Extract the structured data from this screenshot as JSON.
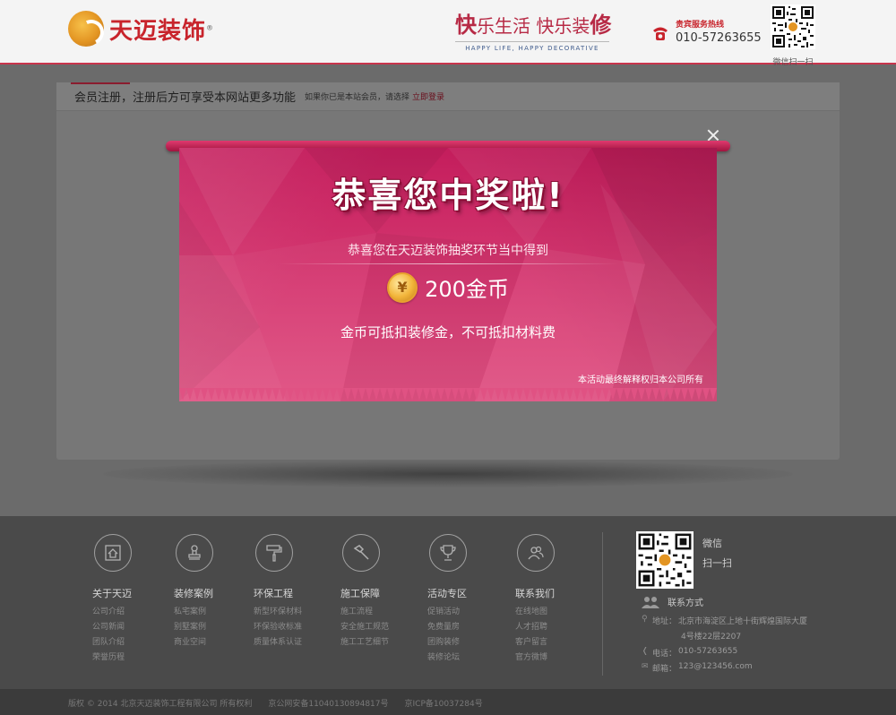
{
  "header": {
    "brand": "天迈装饰",
    "brand_mark": "®",
    "slogan_k1": "快",
    "slogan_rest": "乐生活",
    "slogan_second": "快乐装",
    "slogan_k2": "修",
    "slogan_en": "HAPPY LIFE, HAPPY DECORATIVE",
    "hotline_label": "贵宾服务热线",
    "hotline_number": "010-57263655",
    "qr_caption": "微信扫一扫"
  },
  "register": {
    "title": "会员注册，注册后方可享受本网站更多功能",
    "prompt": "如果你已是本站会员，请选择",
    "login_link": "立即登录"
  },
  "modal": {
    "title": "恭喜您中奖啦!",
    "line1": "恭喜您在天迈装饰抽奖环节当中得到",
    "coin_symbol": "¥",
    "prize": "200金币",
    "line2": "金币可抵扣装修金，不可抵扣材料费",
    "note": "本活动最终解释权归本公司所有"
  },
  "footer": {
    "columns": [
      {
        "icon": "house-icon",
        "title": "关于天迈",
        "links": [
          "公司介绍",
          "公司新闻",
          "团队介绍",
          "荣誉历程"
        ]
      },
      {
        "icon": "stamp-icon",
        "title": "装修案例",
        "links": [
          "私宅案例",
          "别墅案例",
          "商业空间"
        ]
      },
      {
        "icon": "paint-roller-icon",
        "title": "环保工程",
        "links": [
          "新型环保材料",
          "环保验收标准",
          "质量体系认证"
        ]
      },
      {
        "icon": "hammer-icon",
        "title": "施工保障",
        "links": [
          "施工流程",
          "安全施工规范",
          "施工工艺细节"
        ]
      },
      {
        "icon": "trophy-icon",
        "title": "活动专区",
        "links": [
          "促销活动",
          "免费量房",
          "团购装修",
          "装修论坛"
        ]
      },
      {
        "icon": "people-icon",
        "title": "联系我们",
        "links": [
          "在线地图",
          "人才招聘",
          "客户留言",
          "官方微博"
        ]
      }
    ],
    "wechat_line1": "微信",
    "wechat_line2": "扫一扫",
    "contact_title": "联系方式",
    "address_label": "地址：",
    "address_line1": "北京市海淀区上地十街辉煌国际大厦",
    "address_line2": "4号楼22层2207",
    "phone_label": "电话：",
    "phone": "010-57263655",
    "email_label": "邮箱：",
    "email": "123@123456.com",
    "copyright": "版权 © 2014 北京天迈装饰工程有限公司 所有权利　　京公网安备11040130894817号　　京ICP备10037284号"
  },
  "colors": {
    "accent": "#c8344c",
    "banner": "#d63a72",
    "footer": "#4a4a4a"
  }
}
